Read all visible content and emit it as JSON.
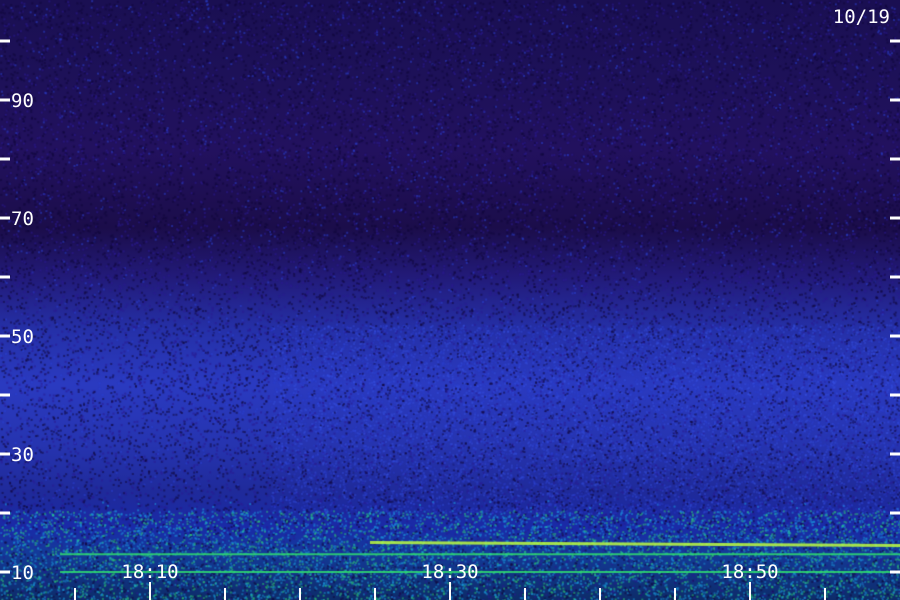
{
  "date": "10/19",
  "chart_data": {
    "type": "heatmap",
    "title": "",
    "xlabel": "",
    "ylabel": "",
    "x_tick_labels": [
      "18:10",
      "18:30",
      "18:50"
    ],
    "y_tick_labels": [
      "10",
      "30",
      "50",
      "70",
      "90"
    ],
    "ylim": [
      10,
      100
    ],
    "colormap": [
      "#10083a",
      "#2a1a90",
      "#2a40d0",
      "#1aa0e0",
      "#30e070",
      "#c0ff40"
    ],
    "features": [
      {
        "kind": "broadband-enhancement",
        "y_range": [
          20,
          52
        ],
        "x_labels_span": [
          "18:10",
          "18:50"
        ]
      },
      {
        "kind": "narrowband-line",
        "y": 15,
        "color": "#c0ff40"
      },
      {
        "kind": "narrowband-line",
        "y": 13,
        "color": "#30e070"
      },
      {
        "kind": "narrowband-line",
        "y": 10,
        "color": "#30e070"
      }
    ],
    "grid": false,
    "legend": "none"
  }
}
